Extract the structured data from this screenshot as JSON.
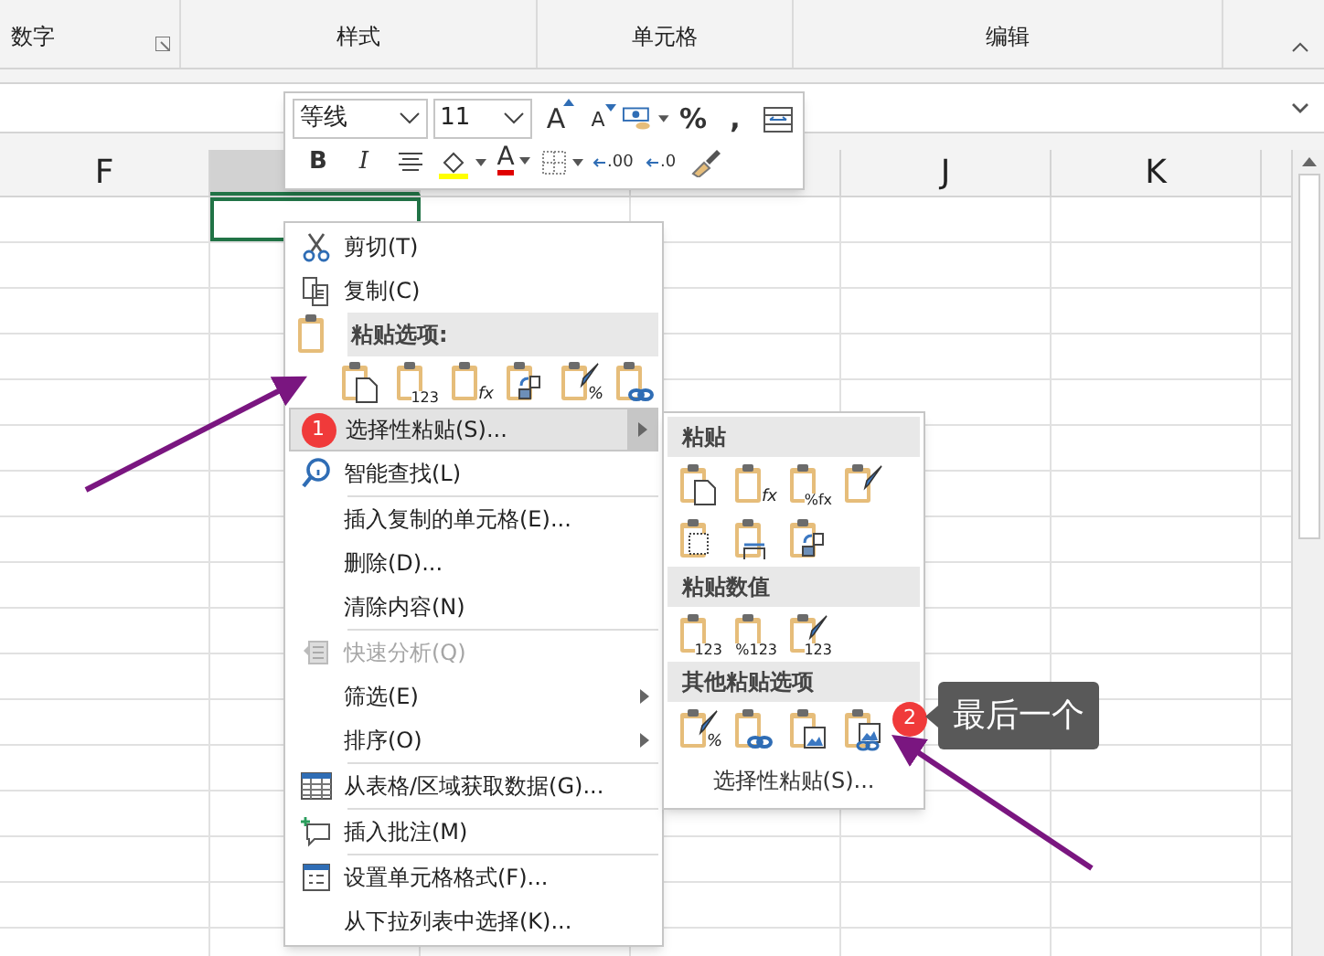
{
  "ribbon": {
    "groups": [
      {
        "label": "数字",
        "launcher": true
      },
      {
        "label": "样式",
        "launcher": false
      },
      {
        "label": "单元格",
        "launcher": false
      },
      {
        "label": "编辑",
        "launcher": false
      }
    ]
  },
  "columns": [
    {
      "label": "F",
      "selected": false
    },
    {
      "selected": true
    },
    {
      "selected": false
    },
    {
      "selected": false
    },
    {
      "label": "J",
      "selected": false
    },
    {
      "label": "K",
      "selected": false
    }
  ],
  "mini_toolbar": {
    "row_1": [
      {
        "kind": "font",
        "value": "等线"
      },
      {
        "kind": "size",
        "value": "11"
      },
      {
        "kind": "grow",
        "glyph": "A"
      },
      {
        "kind": "shrink",
        "glyph": "A"
      },
      {
        "kind": "format"
      },
      {
        "kind": "glyph",
        "glyph": "%"
      },
      {
        "kind": "glyph",
        "glyph": ","
      },
      {
        "kind": "wrap"
      }
    ],
    "row_2": [
      {
        "kind": "bold",
        "glyph": "B"
      },
      {
        "kind": "italic",
        "glyph": "I"
      },
      {
        "kind": "align"
      },
      {
        "kind": "fill"
      },
      {
        "kind": "fontcolor",
        "glyph": "A"
      },
      {
        "kind": "border"
      },
      {
        "kind": "decimal",
        "glyph": ".00"
      },
      {
        "kind": "decimal",
        "glyph": ".0"
      },
      {
        "kind": "brush"
      }
    ]
  },
  "context_menu": {
    "items": [
      {
        "kind": "command",
        "label": "剪切(T)",
        "disabled": false,
        "submenu": false,
        "selected": false
      },
      {
        "kind": "command",
        "label": "复制(C)",
        "disabled": false,
        "submenu": false,
        "selected": false
      },
      {
        "kind": "header",
        "label": "粘贴选项:"
      },
      {
        "kind": "icons",
        "icons": [
          {
            "kind": "doc"
          },
          {
            "kind": "text",
            "mark": "123"
          },
          {
            "kind": "text",
            "mark": "fx"
          },
          {
            "kind": "transpose"
          },
          {
            "kind": "brush",
            "mark": "%"
          },
          {
            "kind": "link"
          }
        ]
      },
      {
        "kind": "command",
        "label": "选择性粘贴(S)...",
        "disabled": false,
        "submenu": true,
        "selected": true,
        "badge": "1"
      },
      {
        "kind": "command",
        "label": "智能查找(L)",
        "disabled": false,
        "submenu": false,
        "selected": false
      },
      {
        "kind": "separator"
      },
      {
        "kind": "command",
        "label": "插入复制的单元格(E)...",
        "disabled": false,
        "submenu": false,
        "selected": false
      },
      {
        "kind": "command",
        "label": "删除(D)...",
        "disabled": false,
        "submenu": false,
        "selected": false
      },
      {
        "kind": "command",
        "label": "清除内容(N)",
        "disabled": false,
        "submenu": false,
        "selected": false
      },
      {
        "kind": "separator"
      },
      {
        "kind": "command",
        "label": "快速分析(Q)",
        "disabled": true,
        "submenu": false,
        "selected": false
      },
      {
        "kind": "command",
        "label": "筛选(E)",
        "disabled": false,
        "submenu": true,
        "selected": false
      },
      {
        "kind": "command",
        "label": "排序(O)",
        "disabled": false,
        "submenu": true,
        "selected": false
      },
      {
        "kind": "separator"
      },
      {
        "kind": "command",
        "label": "从表格/区域获取数据(G)...",
        "disabled": false,
        "submenu": false,
        "selected": false
      },
      {
        "kind": "separator"
      },
      {
        "kind": "command",
        "label": "插入批注(M)",
        "disabled": false,
        "submenu": false,
        "selected": false
      },
      {
        "kind": "separator"
      },
      {
        "kind": "command",
        "label": "设置单元格格式(F)...",
        "disabled": false,
        "submenu": false,
        "selected": false
      },
      {
        "kind": "command",
        "label": "从下拉列表中选择(K)...",
        "disabled": false,
        "submenu": false,
        "selected": false
      }
    ]
  },
  "submenu": {
    "items": [
      {
        "kind": "header",
        "label": "粘贴"
      },
      {
        "kind": "icons",
        "icons": [
          {
            "kind": "doc"
          },
          {
            "kind": "text",
            "mark": "fx"
          },
          {
            "kind": "text",
            "mark": "%fx"
          },
          {
            "kind": "brush"
          }
        ]
      },
      {
        "kind": "icons",
        "icons": [
          {
            "kind": "dotted"
          },
          {
            "kind": "width"
          },
          {
            "kind": "transpose"
          }
        ]
      },
      {
        "kind": "header",
        "label": "粘贴数值"
      },
      {
        "kind": "icons",
        "icons": [
          {
            "kind": "text",
            "mark": "123"
          },
          {
            "kind": "text",
            "mark": "%123"
          },
          {
            "kind": "brush",
            "mark": "123"
          }
        ]
      },
      {
        "kind": "header",
        "label": "其他粘贴选项"
      },
      {
        "kind": "icons",
        "icons": [
          {
            "kind": "brush",
            "mark": "%"
          },
          {
            "kind": "link"
          },
          {
            "kind": "picture"
          },
          {
            "kind": "linkedpicture",
            "badge": "2"
          }
        ]
      },
      {
        "kind": "command",
        "label": "选择性粘贴(S)..."
      }
    ]
  },
  "tooltip": {
    "text": "最后一个"
  }
}
